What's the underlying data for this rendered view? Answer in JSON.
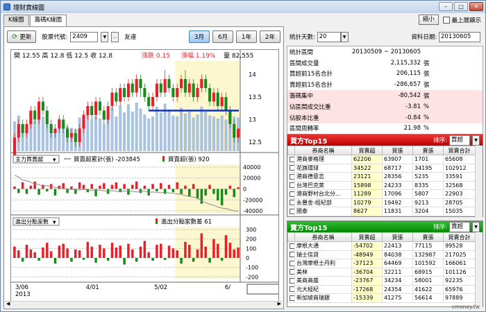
{
  "window": {
    "title": "理財寶線圖"
  },
  "tabs": [
    {
      "label": "K線圖"
    },
    {
      "label": "籌碼K線圖"
    }
  ],
  "top_right": {
    "shrink_label": "縮小",
    "ontop_label": "最上層顯示"
  },
  "toolbar": {
    "update_label": "更新",
    "stock_code_label": "股票代號:",
    "stock_code_value": "2409",
    "stock_name": "友達",
    "range_buttons": [
      "3月",
      "6月",
      "1年",
      "2年"
    ],
    "active_range": "3月"
  },
  "quote": {
    "open_label": "開",
    "open": "12.55",
    "high_label": "高",
    "high": "12.8",
    "low_label": "低",
    "low": "12.5",
    "close_label": "收",
    "close": "12.8",
    "change_label": "漲跌",
    "change": "0.15",
    "pct_label": "漲幅",
    "pct": "1.19%",
    "vol_label": "量",
    "vol": "82,555"
  },
  "chart_data": {
    "type": "candlestick",
    "price_ticks": [
      "14",
      "13.5",
      "13",
      "12.5"
    ],
    "price_range": [
      12.3,
      14.3
    ],
    "support_line": 13.2,
    "x_labels": [
      "3/06\n2013",
      "4/01",
      "5/02",
      "6/"
    ],
    "highlight_start_index": 40,
    "candles": [
      [
        12.2,
        12.6,
        12.1,
        12.7
      ],
      [
        12.6,
        12.9,
        12.5,
        13.0
      ],
      [
        12.9,
        12.7,
        12.6,
        13.0
      ],
      [
        12.7,
        12.9,
        12.6,
        13.0
      ],
      [
        12.9,
        13.2,
        12.8,
        13.3
      ],
      [
        13.2,
        13.0,
        12.9,
        13.3
      ],
      [
        13.0,
        13.4,
        12.9,
        13.5
      ],
      [
        13.4,
        13.2,
        13.1,
        13.5
      ],
      [
        13.2,
        12.9,
        12.8,
        13.3
      ],
      [
        12.9,
        12.7,
        12.6,
        13.0
      ],
      [
        12.7,
        12.8,
        12.6,
        12.9
      ],
      [
        12.8,
        13.0,
        12.7,
        13.1
      ],
      [
        13.0,
        12.8,
        12.7,
        13.1
      ],
      [
        12.8,
        12.6,
        12.5,
        12.9
      ],
      [
        12.6,
        12.7,
        12.5,
        12.8
      ],
      [
        12.7,
        12.5,
        12.4,
        12.8
      ],
      [
        12.5,
        12.8,
        12.4,
        12.9
      ],
      [
        12.8,
        13.1,
        12.7,
        13.2
      ],
      [
        13.1,
        13.3,
        13.0,
        13.4
      ],
      [
        13.3,
        13.1,
        13.0,
        13.4
      ],
      [
        13.1,
        13.4,
        13.0,
        13.5
      ],
      [
        13.4,
        13.2,
        13.1,
        13.5
      ],
      [
        13.2,
        13.0,
        12.9,
        13.3
      ],
      [
        13.0,
        13.3,
        12.9,
        13.4
      ],
      [
        13.3,
        13.6,
        13.2,
        13.7
      ],
      [
        13.6,
        13.4,
        13.3,
        13.7
      ],
      [
        13.4,
        13.7,
        13.3,
        13.8
      ],
      [
        13.7,
        13.5,
        13.4,
        13.8
      ],
      [
        13.5,
        13.8,
        13.4,
        13.9
      ],
      [
        13.8,
        13.6,
        13.5,
        13.9
      ],
      [
        13.6,
        13.9,
        13.5,
        14.0
      ],
      [
        13.9,
        13.7,
        13.5,
        14.0
      ],
      [
        13.7,
        13.5,
        13.4,
        13.8
      ],
      [
        13.5,
        13.3,
        13.2,
        13.6
      ],
      [
        13.3,
        13.5,
        13.2,
        13.6
      ],
      [
        13.5,
        13.8,
        13.4,
        13.9
      ],
      [
        13.8,
        13.6,
        13.5,
        13.9
      ],
      [
        13.6,
        13.9,
        13.5,
        14.1
      ],
      [
        13.9,
        13.7,
        13.6,
        14.0
      ],
      [
        13.7,
        13.5,
        13.4,
        13.8
      ],
      [
        13.5,
        13.7,
        13.4,
        13.8
      ],
      [
        13.7,
        13.9,
        13.6,
        14.0
      ],
      [
        13.9,
        13.6,
        13.5,
        14.1
      ],
      [
        13.6,
        13.8,
        13.5,
        13.9
      ],
      [
        13.8,
        13.5,
        13.4,
        13.9
      ],
      [
        13.5,
        13.7,
        13.4,
        13.8
      ],
      [
        13.7,
        13.9,
        13.6,
        14.0
      ],
      [
        13.9,
        13.7,
        13.6,
        14.0
      ],
      [
        13.7,
        13.4,
        13.3,
        13.8
      ],
      [
        13.4,
        13.6,
        13.3,
        13.7
      ],
      [
        13.6,
        13.3,
        13.2,
        13.7
      ],
      [
        13.3,
        13.5,
        13.2,
        13.6
      ],
      [
        13.5,
        13.2,
        13.1,
        13.6
      ],
      [
        13.2,
        12.9,
        12.8,
        13.3
      ],
      [
        12.9,
        12.6,
        12.5,
        13.0
      ],
      [
        12.6,
        12.8,
        12.5,
        12.8
      ]
    ],
    "volume": [
      60,
      72,
      55,
      48,
      80,
      62,
      90,
      70,
      58,
      52,
      45,
      66,
      60,
      50,
      47,
      44,
      68,
      75,
      82,
      64,
      70,
      66,
      55,
      72,
      88,
      70,
      92,
      78,
      95,
      80,
      98,
      86,
      74,
      66,
      70,
      90,
      78,
      96,
      84,
      72,
      70,
      88,
      76,
      80,
      68,
      74,
      90,
      80,
      72,
      70,
      66,
      72,
      64,
      82,
      70,
      68
    ],
    "volume_mode_label": "主力買賣超",
    "cum_legend": "買賣超累計(張)",
    "cum_value": "-203845",
    "net_legend": "買賣超(張)",
    "net_value": "920",
    "mid_ticks": [
      "40000",
      "20000",
      "0",
      "-20000",
      "-40000"
    ],
    "mid_range": [
      -45000,
      45000
    ],
    "net_bars": [
      3,
      -5,
      8,
      -6,
      4,
      9,
      -7,
      5,
      -3,
      6,
      -8,
      4,
      7,
      -5,
      3,
      -6,
      8,
      5,
      -4,
      6,
      -9,
      4,
      7,
      -6,
      5,
      8,
      -4,
      6,
      -7,
      5,
      9,
      -5,
      4,
      -8,
      6,
      -3,
      7,
      -6,
      5,
      -4,
      8,
      -6,
      4,
      -9,
      6,
      -12,
      -18,
      -8,
      5,
      -6,
      -14,
      -20,
      -7,
      4,
      -10,
      2
    ],
    "cum_line": [
      25000,
      22000,
      16000,
      15000,
      12000,
      9000,
      8000,
      5000,
      6000,
      4000,
      3000,
      2000,
      1000,
      0,
      -1000,
      -1500,
      -2000,
      -1000,
      -2500,
      -3000,
      -2000,
      -2500,
      -3500,
      -4000,
      -3000,
      -4500,
      -5000,
      -4000,
      -3500,
      -4500,
      -5500,
      -5000,
      -4000,
      -6000,
      -5500,
      -6500,
      -7000,
      -6000,
      -7500,
      -8000,
      -9000,
      -10000,
      -12000,
      -14000,
      -15000,
      -17000,
      -22000,
      -25000,
      -28000,
      -30000,
      -33000,
      -35000,
      -36000,
      -38000,
      -40000,
      -41000
    ],
    "branch_mode_label": "進出分點家數",
    "branch_legend": "進出分點家數差",
    "branch_value": "61",
    "bottom_ticks": [
      "300",
      "200",
      "100",
      "0",
      "-100",
      "-200"
    ],
    "bottom_range": [
      -220,
      330
    ],
    "branch_bars": [
      120,
      80,
      -40,
      140,
      90,
      60,
      -30,
      110,
      160,
      70,
      -60,
      130,
      150,
      100,
      -40,
      90,
      80,
      -20,
      170,
      120,
      -50,
      140,
      100,
      -30,
      160,
      110,
      130,
      -70,
      150,
      90,
      -40,
      120,
      180,
      60,
      -30,
      140,
      150,
      -20,
      130,
      100,
      80,
      -60,
      170,
      140,
      -40,
      90,
      260,
      120,
      -50,
      200,
      150,
      -30,
      240,
      160,
      90,
      110
    ]
  },
  "right": {
    "days_label": "統計天數:",
    "days_value": "20",
    "date_label": "資料日期:",
    "date_value": "20130605",
    "stats": [
      {
        "label": "統計區間",
        "value": "20130509 ~ 20130605",
        "unit": "",
        "pink": false
      },
      {
        "label": "區間成交量",
        "value": "2,115,332",
        "unit": "張",
        "pink": false
      },
      {
        "label": "買超前15名合計",
        "value": "206,115",
        "unit": "張",
        "pink": false
      },
      {
        "label": "賣超前15名合計",
        "value": "-286,657",
        "unit": "張",
        "pink": false
      },
      {
        "label": "籌碼集中",
        "value": "-80,542",
        "unit": "張",
        "pink": true
      },
      {
        "label": "佔區間成交比重",
        "value": "-3.81",
        "unit": "%",
        "pink": true
      },
      {
        "label": "佔股本比重",
        "value": "-0.84",
        "unit": "%",
        "pink": true
      },
      {
        "label": "區間周轉率",
        "value": "21.98",
        "unit": "%",
        "pink": false
      }
    ],
    "buy_top": {
      "title": "買方Top15",
      "sort_label": "排序:",
      "sort_value": "買超",
      "columns": [
        "券商名稱",
        "買賣超",
        "買張",
        "賣張",
        "買賣合計"
      ],
      "rows": [
        [
          "港商麥格理",
          "62206",
          "63907",
          "1701",
          "65608"
        ],
        [
          "花旗環球",
          "34522",
          "68717",
          "34195",
          "102912"
        ],
        [
          "港商德意志",
          "23121",
          "28356",
          "5235",
          "33591"
        ],
        [
          "台灣巴克萊",
          "15898",
          "24233",
          "8335",
          "32568"
        ],
        [
          "港商野村台北分...",
          "11289",
          "17096",
          "5807",
          "22903"
        ],
        [
          "永豐金-經紀部",
          "10279",
          "19492",
          "9213",
          "28705"
        ],
        [
          "國泰",
          "8627",
          "11831",
          "3204",
          "15035"
        ]
      ]
    },
    "sell_top": {
      "title": "賣方Top15",
      "sort_label": "排序:",
      "sort_value": "賣超",
      "columns": [
        "券商名稱",
        "買賣超",
        "買張",
        "賣張",
        "買賣合計"
      ],
      "rows": [
        [
          "摩根大通",
          "-54702",
          "22413",
          "77115",
          "99528"
        ],
        [
          "瑞士信貸",
          "-48949",
          "84038",
          "132987",
          "217025"
        ],
        [
          "台灣摩根士丹利",
          "-37123",
          "64469",
          "101592",
          "166061"
        ],
        [
          "美林",
          "-36704",
          "32211",
          "68915",
          "101126"
        ],
        [
          "美商高盛",
          "-23767",
          "34234",
          "58001",
          "92235"
        ],
        [
          "元大經紀",
          "-17268",
          "24354",
          "41622",
          "65976"
        ],
        [
          "新加坡商瑞銀",
          "-15339",
          "41275",
          "56614",
          "97889"
        ]
      ]
    }
  },
  "footer": "cmoney.tw",
  "colors": {
    "up": "#e8202a",
    "down": "#1a8a1a",
    "support": "#1030b0",
    "highlight": "#fdf7cf"
  }
}
